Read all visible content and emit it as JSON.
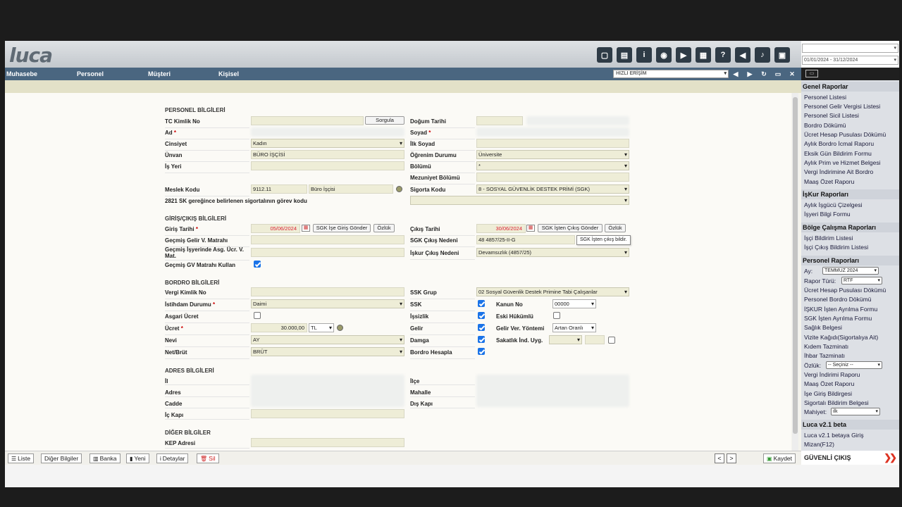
{
  "header": {
    "logo": "luca",
    "toolbar_icons": [
      "document-icon",
      "book-icon",
      "info-icon",
      "globe-icon",
      "youtube-icon",
      "calculator-icon",
      "help-icon",
      "megaphone-icon",
      "bell-icon",
      "notebook-icon"
    ]
  },
  "nav": {
    "menus": [
      "Muhasebe",
      "Personel",
      "Müşteri",
      "Kişisel"
    ],
    "quick_access": "HIZLI ERİŞİM"
  },
  "sections": {
    "personel": "PERSONEL BİLGİLERİ",
    "giris_cikis": "GİRİŞ/ÇIKIŞ BİLGİLERİ",
    "bordro": "BORDRO BİLGİLERİ",
    "adres": "ADRES BİLGİLERİ",
    "diger": "DİĞER BİLGİLER"
  },
  "personel": {
    "tc_label": "TC Kimlik No",
    "sorgula": "Sorgula",
    "ad_label": "Ad",
    "cinsiyet_label": "Cinsiyet",
    "cinsiyet_value": "Kadın",
    "unvan_label": "Ünvan",
    "unvan_value": "BÜRO İŞÇİSİ",
    "is_yeri_label": "İş Yeri",
    "meslek_label": "Meslek Kodu",
    "meslek_kodu": "9112.11",
    "meslek_adi": "Büro İşçisi",
    "gorev_label": "2821 SK gereğince belirlenen sigortalının görev kodu",
    "dogum_label": "Doğum Tarihi",
    "soyad_label": "Soyad",
    "ilk_soyad_label": "İlk Soyad",
    "ogrenim_label": "Öğrenim Durumu",
    "ogrenim_value": "Üniversite",
    "bolum_label": "Bölümü",
    "bolum_value": "*",
    "mezuniyet_label": "Mezuniyet Bölümü",
    "sigorta_label": "Sigorta Kodu",
    "sigorta_value": "8 - SOSYAL GÜVENLİK DESTEK PRİMİ (SGK)"
  },
  "giris": {
    "giris_label": "Giriş Tarihi",
    "giris_value": "05/06/2024",
    "giris_btn": "SGK İşe Giriş Gönder",
    "ozluk": "Özlük",
    "gecmis_gelir_label": "Geçmiş Gelir V. Matrahı",
    "gecmis_asg_label": "Geçmiş İşyerinde Asg. Ücr. V. Mat.",
    "gecmis_gv_label": "Geçmiş GV Matrahı Kullan",
    "cikis_label": "Çıkış Tarihi",
    "cikis_value": "30/06/2024",
    "cikis_btn": "SGK İşten Çıkış Gönder",
    "tooltip": "SGK İşten çıkış bildir.",
    "sgk_neden_label": "SGK Çıkış Nedeni",
    "sgk_neden_value": "48 4857/25-II-G",
    "iskur_neden_label": "İşkur Çıkış Nedeni",
    "iskur_neden_value": "Devamsızlık (4857/25)"
  },
  "bordro": {
    "vergi_label": "Vergi Kimlik No",
    "istihdam_label": "İstihdam Durumu",
    "istihdam_value": "Daimi",
    "asgari_label": "Asgari Ücret",
    "ucret_label": "Ücret",
    "ucret_value": "30.000,00",
    "doviz": "TL",
    "nevi_label": "Nevi",
    "nevi_value": "AY",
    "net_label": "Net/Brüt",
    "net_value": "BRÜT",
    "ssk_grup_label": "SSK Grup",
    "ssk_grup_value": "02 Sosyal Güvenlik Destek Primine Tabi Çalışanlar",
    "ssk_label": "SSK",
    "kanun_label": "Kanun No",
    "kanun_value": "00000",
    "issizlik_label": "İşsizlik",
    "eski_label": "Eski Hükümlü",
    "gelir_label": "Gelir",
    "gelir_yontem_label": "Gelir Ver. Yöntemi",
    "gelir_yontem_value": "Artan Oranlı",
    "damga_label": "Damga",
    "sakatlik_label": "Sakatlık İnd. Uyg.",
    "bordro_hesapla_label": "Bordro Hesapla"
  },
  "adres": {
    "il": "İl",
    "adres": "Adres",
    "cadde": "Cadde",
    "ic_kapi": "İç Kapı",
    "ilce": "İlçe",
    "mahalle": "Mahalle",
    "dis_kapi": "Dış Kapı"
  },
  "diger": {
    "kep": "KEP Adresi"
  },
  "bottom": {
    "liste": "Liste",
    "diger": "Diğer Bilgiler",
    "banka": "Banka",
    "yeni": "Yeni",
    "detaylar": "Detaylar",
    "sil": "Sil",
    "kaydet": "Kaydet"
  },
  "sidebar": {
    "date_range": "01/01/2024 - 31/12/2024",
    "genel_title": "Genel Raporlar",
    "genel_items": [
      "Personel Listesi",
      "Personel Gelir Vergisi Listesi",
      "Personel Sicil Listesi",
      "Bordro Dökümü",
      "Ücret Hesap Pusulası Dökümü",
      "Aylık Bordro İcmal Raporu",
      "Eksik Gün Bildirim Formu",
      "Aylık Prim ve Hizmet Belgesi",
      "Vergi İndirimine Ait Bordro",
      "Maaş Özet Raporu"
    ],
    "iskur_title": "İşKur Raporları",
    "iskur_items": [
      "Aylık İşgücü Çizelgesi",
      "İşyeri Bilgi Formu"
    ],
    "bolge_title": "Bölge Çalışma Raporları",
    "bolge_items": [
      "İşçi Bildirim Listesi",
      "İşçi Çıkış Bildirim Listesi"
    ],
    "personel_title": "Personel Raporları",
    "ay_label": "Ay:",
    "ay_value": "TEMMUZ 2024",
    "rapor_label": "Rapor Türü:",
    "rapor_value": "RTF",
    "personel_items": [
      "Ücret Hesap Pusulası Dökümü",
      "Personel Bordro Dökümü",
      "İŞKUR İşten Ayrılma Formu",
      "SGK İşten Ayrılma Formu",
      "Sağlık Belgesi",
      "Vizite Kağıdı(Sigortalıya Ait)",
      "Kıdem Tazminatı",
      "İhbar Tazminatı"
    ],
    "ozluk_label": "Özlük:",
    "ozluk_value": "-- Seçiniz --",
    "personel_items2": [
      "Vergi İndirimi Raporu",
      "Maaş Özet Raporu",
      "İşe Giriş Bildirgesi",
      "Sigortalı Bildirim Belgesi"
    ],
    "mahiyet_label": "Mahiyet:",
    "mahiyet_value": "ilk",
    "luca_title": "Luca v2.1 beta",
    "luca_items": [
      "Luca v2.1 betaya Giriş",
      "Mizan(F12)"
    ],
    "logout": "GÜVENLİ ÇIKIŞ"
  }
}
